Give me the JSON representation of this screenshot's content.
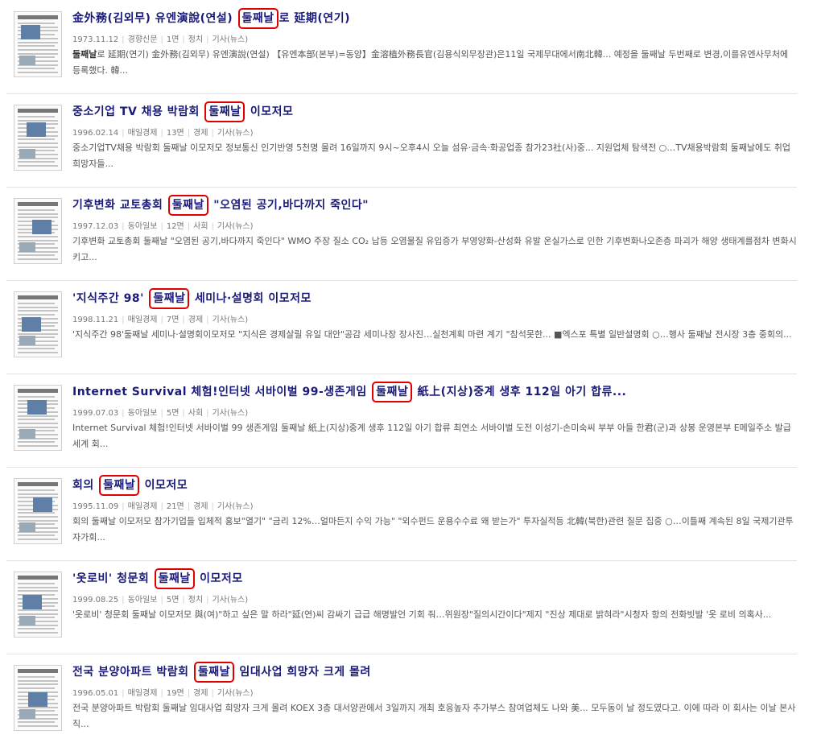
{
  "results": [
    {
      "title_before": "金外務(김외무) 유엔演說(연설) ",
      "keyword": "둘째날",
      "title_after": "로 延期(연기)",
      "date": "1973.11.12",
      "paper": "경향신문",
      "page": "1면",
      "section": "정치",
      "type": "기사(뉴스)",
      "snippet_kw": "둘째날",
      "snippet": "로 延期(연기) 金外務(김외무) 유엔演說(연설) 【유엔本部(본부)=동양】金溶植外務長官(김용식외무장관)은11일 국제무대에서南北韓... 예정을 둘째날 두번째로 변경,이를유엔사무처에 등록했다. 韓..."
    },
    {
      "title_before": "중소기업 TV 채용 박람회 ",
      "keyword": "둘째날",
      "title_after": " 이모저모",
      "date": "1996.02.14",
      "paper": "매일경제",
      "page": "13면",
      "section": "경제",
      "type": "기사(뉴스)",
      "snippet_kw": "",
      "snippet": "중소기업TV채용 박람회 둘째날 이모저모 정보통신 인기반영 5천명 몰려 16일까지 9시~오후4시 오늘 섬유·금속·화공업종 참가23社(사)중... 지원업체 탐색전 ○…TV채용박람회 둘째날에도 취업희망자들..."
    },
    {
      "title_before": "기후변화 교토총회 ",
      "keyword": "둘째날",
      "title_after": " \"오염된 공기,바다까지 죽인다\"",
      "date": "1997.12.03",
      "paper": "동아일보",
      "page": "12면",
      "section": "사회",
      "type": "기사(뉴스)",
      "snippet_kw": "",
      "snippet": "기후변화 교토총회 둘째날 \"오염된 공기,바다까지 죽인다\" WMO 주장 질소 CO₂ 납등 오염물질 유입증가 부영양화-산성화 유발 온실가스로 인한 기후변화나오존층 파괴가 해양 생태계를점차 변화시키고..."
    },
    {
      "title_before": "'지식주간 98' ",
      "keyword": "둘째날",
      "title_after": " 세미나·설명회 이모저모",
      "date": "1998.11.21",
      "paper": "매일경제",
      "page": "7면",
      "section": "경제",
      "type": "기사(뉴스)",
      "snippet_kw": "",
      "snippet": "'지식주간 98'둘째날 세미나·설명회이모저모 \"지식은 경제살릴 유일 대안\"공감 세미나장 장사진…실천계획 마련 계기 \"참석못한... ■엑스포 특별 일반설명회 ○…행사 둘째날 전시장 3층 중회의..."
    },
    {
      "title_before": "Internet Survival 체험!인터넷 서바이벌 99-생존게임 ",
      "keyword": "둘째날",
      "title_after": " 紙上(지상)중계 생후 112일 아기 합류...",
      "date": "1999.07.03",
      "paper": "동아일보",
      "page": "5면",
      "section": "사회",
      "type": "기사(뉴스)",
      "snippet_kw": "",
      "snippet": "Internet Survival 체험!인터넷 서바이벌 99 생존게임 둘째날 紙上(지상)중계 생후 112일 아기 합류 최연소 서바이벌 도전 이성기-손미숙씨 부부 아들 한君(군)과 상봉 운영본부 E메일주소 발급 세계 회..."
    },
    {
      "title_before": "회의 ",
      "keyword": "둘째날",
      "title_after": " 이모저모",
      "date": "1995.11.09",
      "paper": "매일경제",
      "page": "21면",
      "section": "경제",
      "type": "기사(뉴스)",
      "snippet_kw": "",
      "snippet": "회의 둘째날 이모저모 참가기업들 입체적 홍보\"열기\" \"금리 12%…얼마든지 수익 가능\" \"외수펀드 운용수수료 왜 받는가\" 투자실적등 北韓(북한)관련 질문 집중 ○…이틀째 계속된 8일 국제기관투자가회..."
    },
    {
      "title_before": "'옷로비' 청문회 ",
      "keyword": "둘째날",
      "title_after": " 이모저모",
      "date": "1999.08.25",
      "paper": "동아일보",
      "page": "5면",
      "section": "정치",
      "type": "기사(뉴스)",
      "snippet_kw": "",
      "snippet": "'옷로비' 청문회 둘째날 이모저모 與(여)\"하고 싶은 말 하라\"延(연)씨 감싸기 급급 해명발언 기회 줘…위원장\"질의시간이다\"제지 \"진상 제대로 밝혀라\"시청자 항의 전화빗발 '옷 로비 의혹사..."
    },
    {
      "title_before": "전국 분양아파트 박람회 ",
      "keyword": "둘째날",
      "title_after": " 임대사업 희망자 크게 몰려",
      "date": "1996.05.01",
      "paper": "매일경제",
      "page": "19면",
      "section": "경제",
      "type": "기사(뉴스)",
      "snippet_kw": "",
      "snippet": "전국 분양아파트 박람회 둘째날 임대사업 희망자 크게 몰려 KOEX 3층 대서양관에서 3일까지 개최 호응높자 추가부스 참여업체도 나와 美... 모두동이 날 정도였다고. 이에 따라 이 회사는 이날 본사 직..."
    }
  ]
}
